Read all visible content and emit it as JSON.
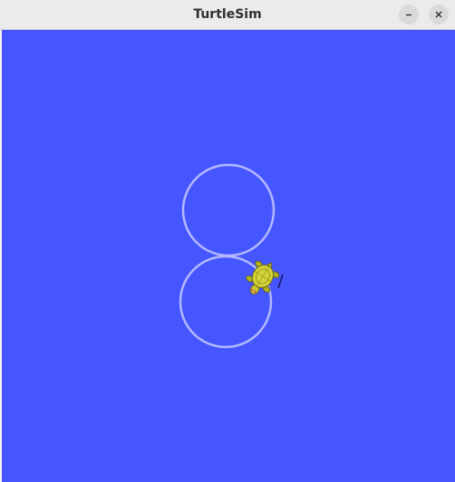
{
  "window": {
    "title": "TurtleSim",
    "minimize_icon": "minimize-icon",
    "close_icon": "close-icon"
  },
  "canvas": {
    "background_color": "#4556ff",
    "trail_color": "#b3b8ff",
    "turtle_icon": "turtle-icon"
  }
}
